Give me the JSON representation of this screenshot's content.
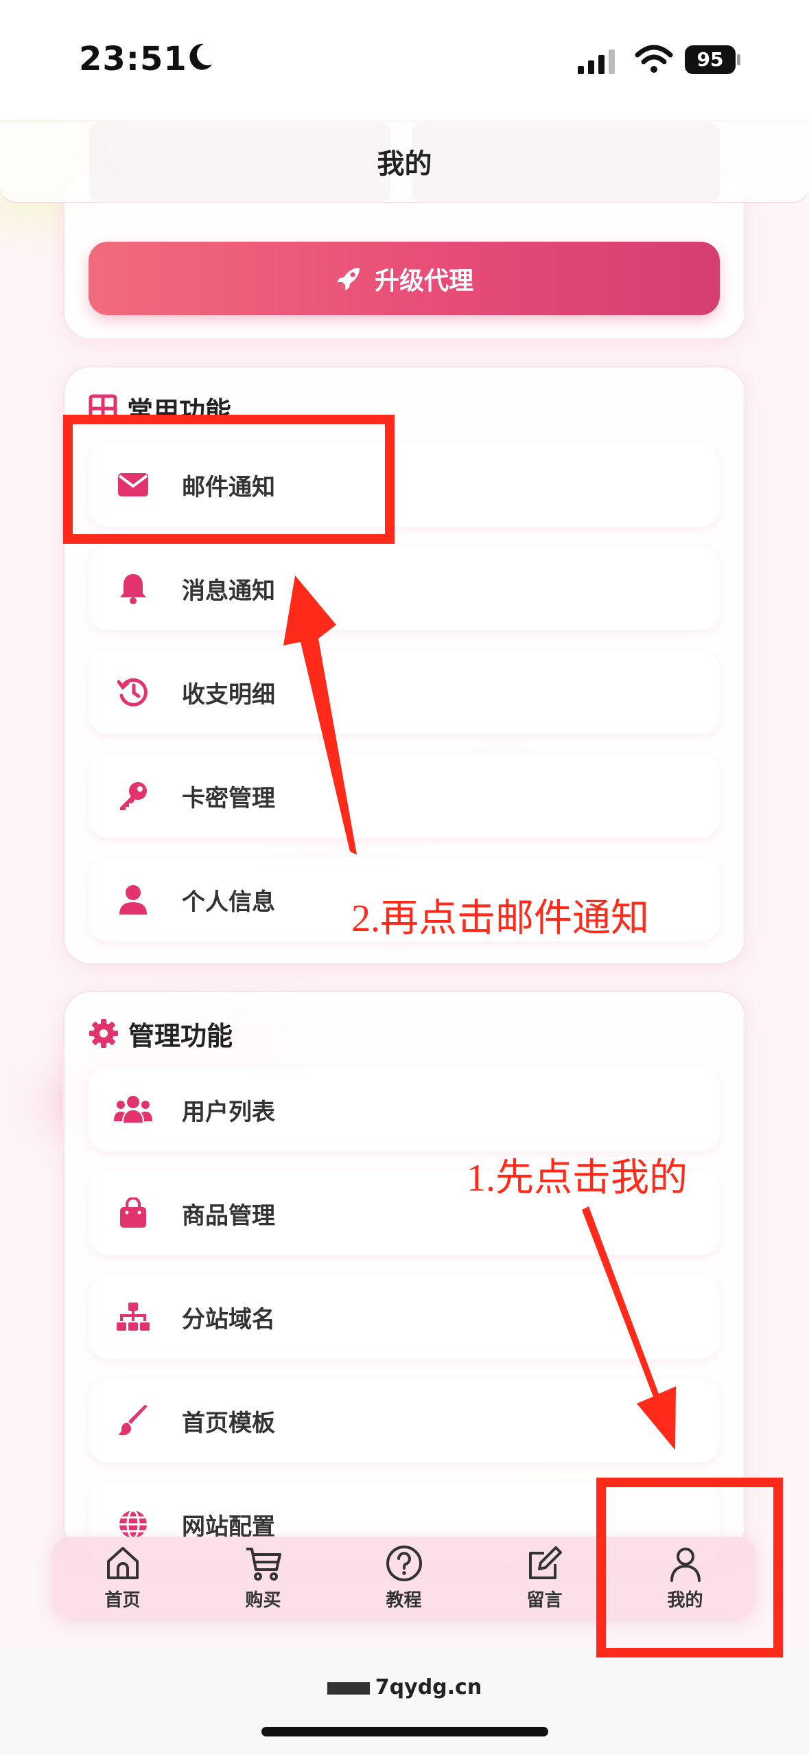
{
  "status_bar": {
    "time": "23:51",
    "battery": "95"
  },
  "header": {
    "title": "我的"
  },
  "upgrade": {
    "button_label": "升级代理"
  },
  "common_section": {
    "title": "常用功能",
    "items": [
      {
        "label": "邮件通知",
        "icon": "envelope-icon"
      },
      {
        "label": "消息通知",
        "icon": "bell-icon"
      },
      {
        "label": "收支明细",
        "icon": "history-icon"
      },
      {
        "label": "卡密管理",
        "icon": "key-icon"
      },
      {
        "label": "个人信息",
        "icon": "user-icon"
      }
    ]
  },
  "admin_section": {
    "title": "管理功能",
    "items": [
      {
        "label": "用户列表",
        "icon": "users-icon"
      },
      {
        "label": "商品管理",
        "icon": "shopping-bag-icon"
      },
      {
        "label": "分站域名",
        "icon": "sitemap-icon"
      },
      {
        "label": "首页模板",
        "icon": "paintbrush-icon"
      },
      {
        "label": "网站配置",
        "icon": "globe-icon"
      }
    ]
  },
  "tab_bar": {
    "tabs": [
      {
        "label": "首页",
        "icon": "home-icon"
      },
      {
        "label": "购买",
        "icon": "cart-icon"
      },
      {
        "label": "教程",
        "icon": "help-icon"
      },
      {
        "label": "留言",
        "icon": "edit-icon"
      },
      {
        "label": "我的",
        "icon": "profile-icon"
      }
    ]
  },
  "browser": {
    "url": "7qydg.cn"
  },
  "annotations": {
    "step1": "1.先点击我的",
    "step2": "2.再点击邮件通知"
  },
  "colors": {
    "accent": "#e2336f",
    "annotation_red": "#ff2a1a",
    "button_gradient_start": "#f16b7d",
    "button_gradient_end": "#d63e72"
  }
}
